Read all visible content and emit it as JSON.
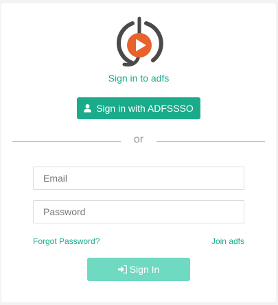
{
  "brand": {
    "logo_icon": "play-logo-icon",
    "accent_color": "#1aab8a",
    "logo_ring_color": "#4a4a4a",
    "logo_play_color": "#e8622b"
  },
  "header": {
    "title": "Sign in to adfs"
  },
  "sso": {
    "label": "Sign in with ADFSSSO",
    "icon": "user-icon"
  },
  "divider": {
    "text": "or"
  },
  "form": {
    "email_placeholder": "Email",
    "email_value": "",
    "password_placeholder": "Password",
    "password_value": "",
    "forgot_label": "Forgot Password?",
    "join_label": "Join adfs",
    "submit_label": "Sign In",
    "submit_icon": "sign-in-icon",
    "submit_color": "#6fd9c1"
  }
}
